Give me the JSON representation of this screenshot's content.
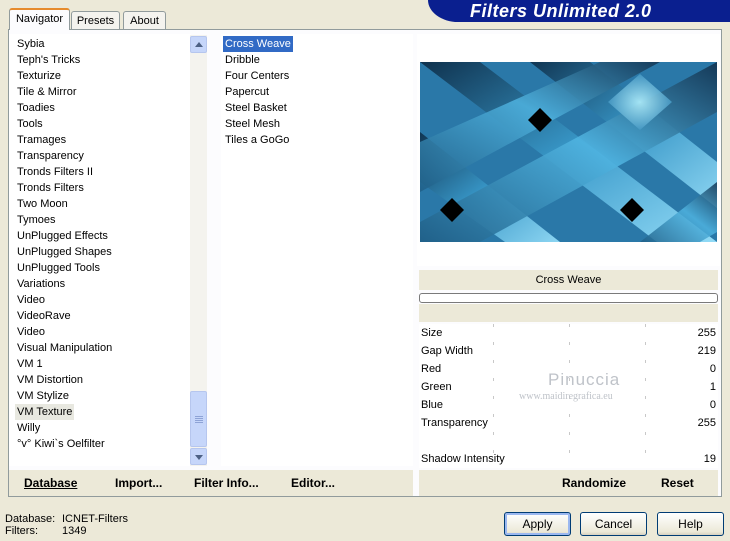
{
  "banner": {
    "title": "Filters Unlimited 2.0"
  },
  "tabs": [
    {
      "label": "Navigator",
      "active": true
    },
    {
      "label": "Presets",
      "active": false
    },
    {
      "label": "About",
      "active": false
    }
  ],
  "categories": [
    "Sybia",
    "Teph's Tricks",
    "Texturize",
    "Tile & Mirror",
    "Toadies",
    "Tools",
    "Tramages",
    "Transparency",
    "Tronds Filters II",
    "Tronds Filters",
    "Two Moon",
    "Tymoes",
    "UnPlugged Effects",
    "UnPlugged Shapes",
    "UnPlugged Tools",
    "Variations",
    "Video",
    "VideoRave",
    "Video",
    "Visual Manipulation",
    "VM 1",
    "VM Distortion",
    "VM Stylize",
    "VM Texture",
    "Willy",
    "°v° Kiwi`s Oelfilter"
  ],
  "selected_category": "VM Texture",
  "filters": [
    "Cross Weave",
    "Dribble",
    "Four Centers",
    "Papercut",
    "Steel Basket",
    "Steel Mesh",
    "Tiles a GoGo"
  ],
  "selected_filter": "Cross Weave",
  "filter_name": "Cross Weave",
  "params": [
    {
      "label": "Size",
      "value": "255"
    },
    {
      "label": "Gap Width",
      "value": "219"
    },
    {
      "label": "Red",
      "value": "0"
    },
    {
      "label": "Green",
      "value": "1"
    },
    {
      "label": "Blue",
      "value": "0"
    },
    {
      "label": "Transparency",
      "value": "255"
    },
    {
      "label": "",
      "value": ""
    },
    {
      "label": "Shadow Intensity",
      "value": "19"
    }
  ],
  "bottom_links": {
    "database": "Database",
    "import": "Import...",
    "filter_info": "Filter Info...",
    "editor": "Editor...",
    "randomize": "Randomize",
    "reset": "Reset"
  },
  "status": {
    "database_label": "Database:",
    "database_value": "ICNET-Filters",
    "filters_label": "Filters:",
    "filters_value": "1349"
  },
  "buttons": {
    "apply": "Apply",
    "cancel": "Cancel",
    "help": "Help"
  },
  "watermark": {
    "name": "Pinuccia",
    "site": "www.maidiregrafica.eu"
  },
  "icons": {
    "scroll_up": "chevron-up-icon",
    "scroll_down": "chevron-down-icon"
  },
  "colors": {
    "banner": "#0a1f8f",
    "selection": "#316ac5",
    "tab_highlight": "#e68b2c"
  }
}
